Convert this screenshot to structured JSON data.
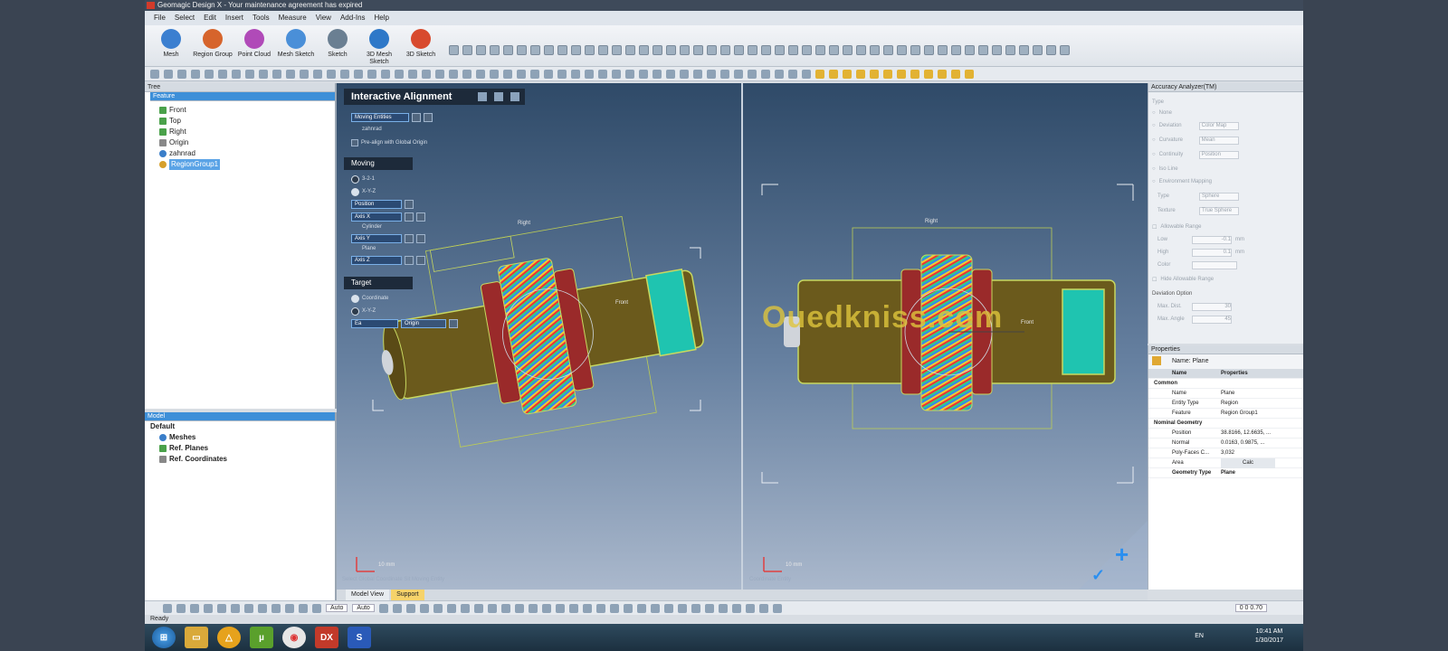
{
  "window": {
    "title": "Geomagic Design X - Your maintenance agreement has expired"
  },
  "menu": [
    "File",
    "Select",
    "Edit",
    "Insert",
    "Tools",
    "Measure",
    "View",
    "Add-Ins",
    "Help"
  ],
  "ribbon": [
    {
      "label": "Mesh",
      "color": "#3b7fd0"
    },
    {
      "label": "Region Group",
      "color": "#d6642c"
    },
    {
      "label": "Point Cloud",
      "color": "#b04ab8"
    },
    {
      "label": "Mesh Sketch",
      "color": "#4a8fd8"
    },
    {
      "label": "Sketch",
      "color": "#6a7f92"
    },
    {
      "label": "3D Mesh Sketch",
      "color": "#2e78c8"
    },
    {
      "label": "3D Sketch",
      "color": "#d84a2e"
    }
  ],
  "tree": {
    "header": "Tree",
    "root": "Feature",
    "items": [
      "Front",
      "Top",
      "Right",
      "Origin",
      "zahnrad",
      "RegionGroup1"
    ]
  },
  "model": {
    "header": "Model",
    "root": "Default",
    "items": [
      "Meshes",
      "Ref. Planes",
      "Ref. Coordinates"
    ]
  },
  "interactive": {
    "title": "Interactive Alignment",
    "moving_entities": "Moving Entities",
    "entity_name": "zahnrad",
    "prealign": "Pre-align with Global Origin",
    "moving_label": "Moving",
    "opt1": "3-2-1",
    "opt2": "X-Y-Z",
    "position": "Position",
    "axis_x": "Axis X",
    "cylinder": "Cylinder",
    "axis_y": "Axis Y",
    "plane": "Plane",
    "axis_z": "Axis Z",
    "target_label": "Target",
    "target_opt1": "Coordinate",
    "target_opt2": "X-Y-Z",
    "ea": "Ea",
    "origin": "Origin"
  },
  "viewport": {
    "watermark": "Ouedkniss.com",
    "left_top_label": "Right",
    "left_mid_label": "Front",
    "right_top_label": "Right",
    "right_mid_label": "Front",
    "scale": "10 mm",
    "left_status": "Select Global Coordinate Sit Moving Entity",
    "right_status": "Coordinate Entity"
  },
  "accuracy": {
    "header": "Accuracy Analyzer(TM)",
    "type": "Type",
    "rows": [
      {
        "label": "None",
        "value": ""
      },
      {
        "label": "Deviation",
        "value": "Color Map"
      },
      {
        "label": "Curvature",
        "value": "Mean"
      },
      {
        "label": "Continuity",
        "value": "Position"
      },
      {
        "label": "Iso Line",
        "value": ""
      },
      {
        "label": "Environment Mapping",
        "value": ""
      },
      {
        "label": "Type",
        "value": "Sphere"
      },
      {
        "label": "Texture",
        "value": "True Sphere"
      }
    ],
    "allowable": "Allowable Range",
    "low_label": "Low",
    "low": "-0.1",
    "unit1": "mm",
    "high_label": "High",
    "high": "0.1",
    "unit2": "mm",
    "color_label": "Color",
    "hide": "Hide Allowable Range",
    "deviation_option": "Deviation Option",
    "max_dist": "Max. Dist.",
    "max_dist_val": "30",
    "max_angle": "Max. Angle",
    "max_angle_val": "45"
  },
  "properties": {
    "header": "Properties",
    "name_line": "Name: Plane",
    "col_name": "Name",
    "col_props": "Properties",
    "rows": [
      {
        "name": "Common",
        "value": ""
      },
      {
        "name": "Name",
        "value": "Plane"
      },
      {
        "name": "Entity Type",
        "value": "Region"
      },
      {
        "name": "Feature",
        "value": "Region Group1"
      },
      {
        "name": "Nominal Geometry",
        "value": ""
      },
      {
        "name": "Position",
        "value": "38.8166, 12.6635, ..."
      },
      {
        "name": "Normal",
        "value": "0.0163, 0.9875, ..."
      },
      {
        "name": "Poly-Faces C...",
        "value": "3,032"
      },
      {
        "name": "Area",
        "value": "Calc"
      },
      {
        "name": "Geometry Type",
        "value": "Plane"
      }
    ]
  },
  "bottom_tabs": [
    "Model View",
    "Support"
  ],
  "toolbar3": {
    "auto1": "Auto",
    "auto2": "Auto"
  },
  "status": {
    "text": "Ready",
    "readout": "0 0 0.70"
  },
  "taskbar": {
    "lang": "EN",
    "time": "10:41 AM",
    "date": "1/30/2017"
  }
}
